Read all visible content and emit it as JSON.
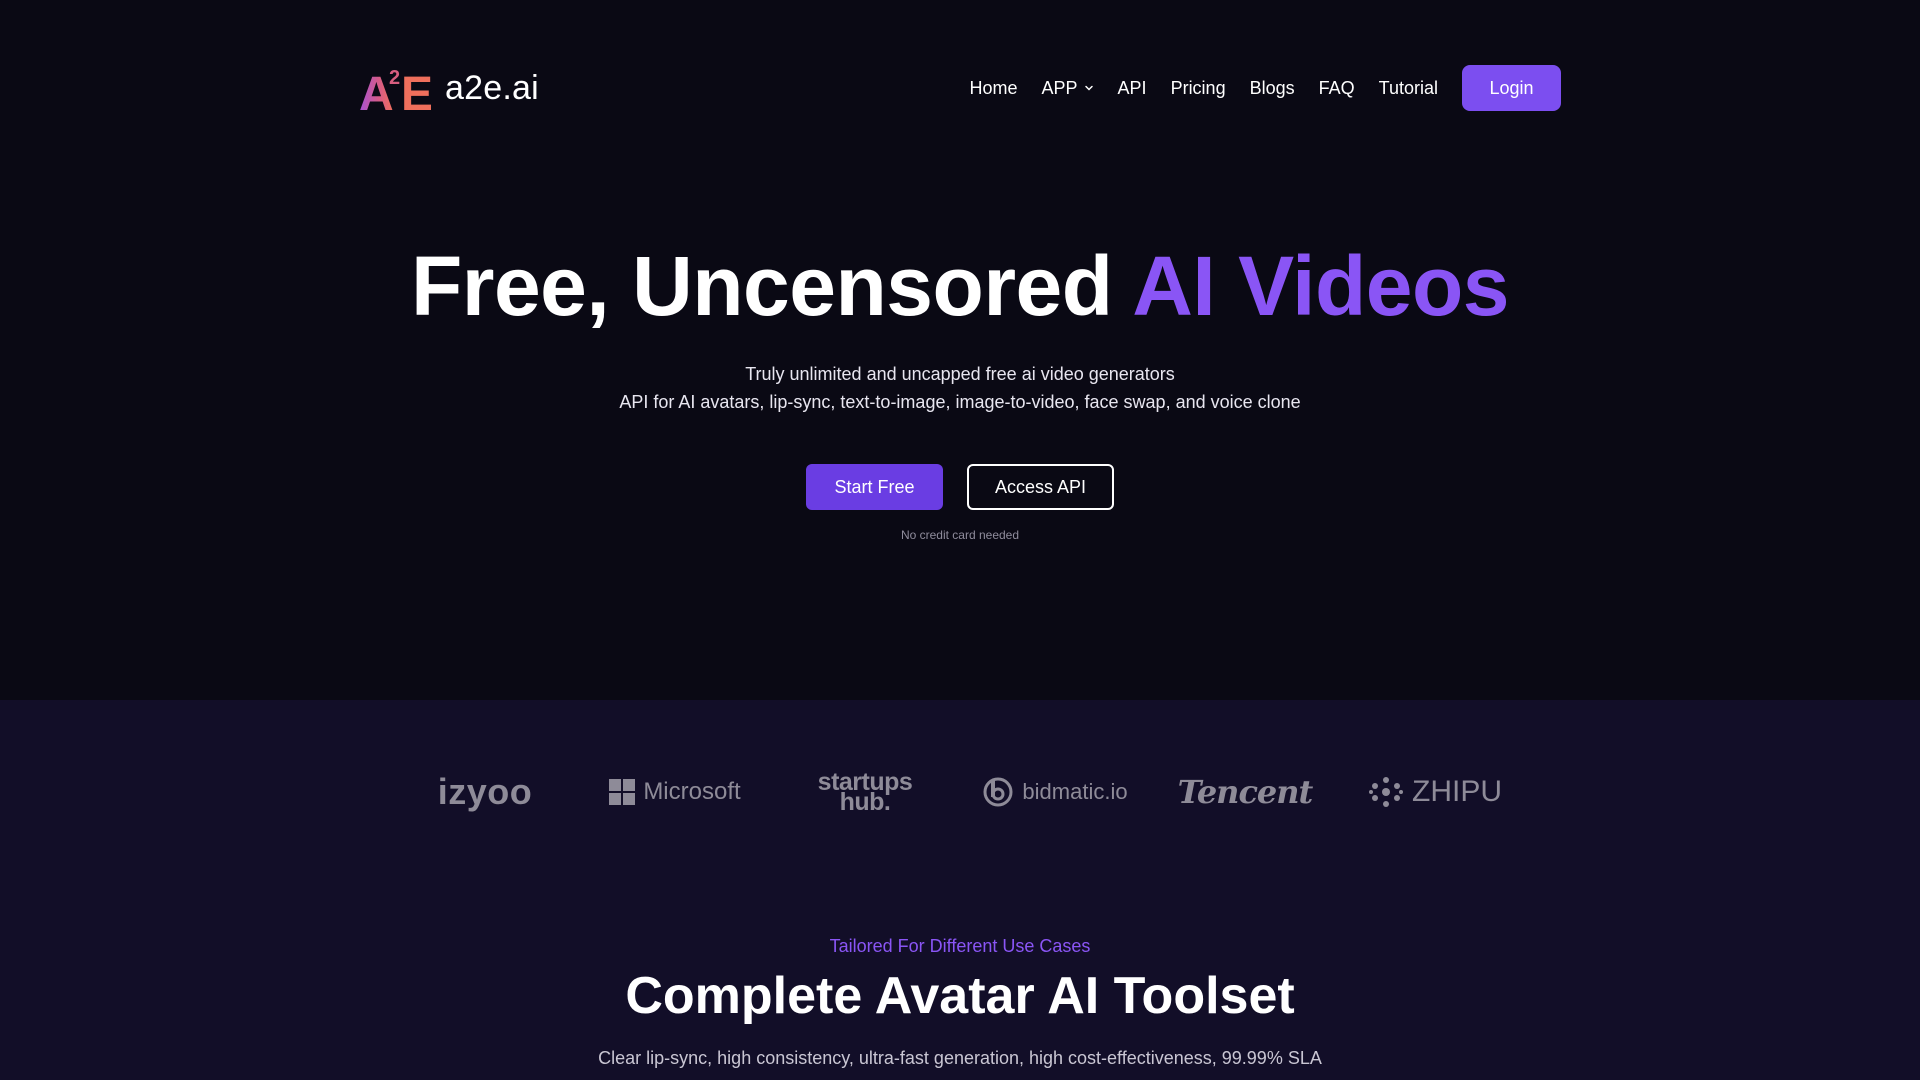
{
  "brand": {
    "logo_mark": "A²E",
    "name": "a2e.ai"
  },
  "nav": {
    "items": [
      {
        "label": "Home"
      },
      {
        "label": "APP",
        "icon": "chevron-down-icon"
      },
      {
        "label": "API"
      },
      {
        "label": "Pricing"
      },
      {
        "label": "Blogs"
      },
      {
        "label": "FAQ"
      },
      {
        "label": "Tutorial"
      }
    ],
    "login_label": "Login"
  },
  "hero": {
    "title_plain": "Free, Uncensored ",
    "title_accent": "AI Videos",
    "subtitle_line1": "Truly unlimited and uncapped free ai video generators",
    "subtitle_line2": "API for AI avatars, lip-sync, text-to-image, image-to-video, face swap, and voice clone",
    "primary_cta": "Start Free",
    "secondary_cta": "Access API",
    "note": "No credit card needed"
  },
  "partners": [
    {
      "name": "izyoo"
    },
    {
      "name": "Microsoft",
      "icon": "windows-logo-icon"
    },
    {
      "name_line1": "startups",
      "name_line2": "hub."
    },
    {
      "name": "bidmatic.io",
      "icon": "bidmatic-logo-icon"
    },
    {
      "name": "Tencent"
    },
    {
      "name": "ZHIPU",
      "icon": "zhipu-logo-icon"
    }
  ],
  "section": {
    "kicker": "Tailored For Different Use Cases",
    "title": "Complete Avatar AI Toolset",
    "subtitle": "Clear lip-sync, high consistency, ultra-fast generation, high cost-effectiveness, 99.99% SLA"
  },
  "colors": {
    "background": "#0a0914",
    "band_background": "#120e28",
    "accent": "#8a55f5",
    "primary_button": "#6a3de3",
    "login_button": "#7c4ef0",
    "muted_logo": "#8e8b98"
  }
}
